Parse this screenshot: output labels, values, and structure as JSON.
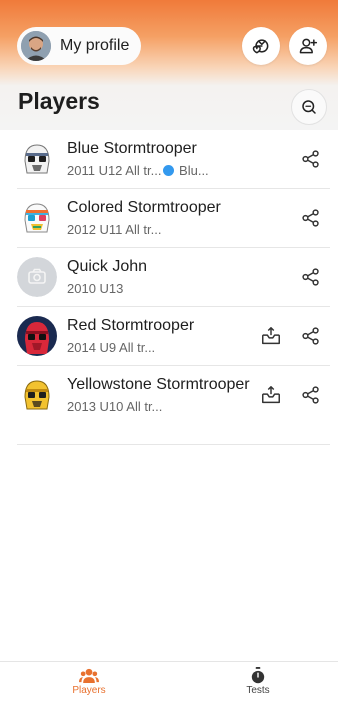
{
  "header": {
    "profile_label": "My profile"
  },
  "page": {
    "title": "Players"
  },
  "players": [
    {
      "name": "Blue Stormtrooper",
      "sub_before_dot": "2011 U12 All tr...",
      "sub_after_dot": " Blu...",
      "has_dot": true,
      "has_inbox": false
    },
    {
      "name": "Colored Stormtrooper",
      "sub_before_dot": "2012 U11 All tr...",
      "sub_after_dot": "",
      "has_dot": false,
      "has_inbox": false
    },
    {
      "name": "Quick John",
      "sub_before_dot": "2010 U13",
      "sub_after_dot": "",
      "has_dot": false,
      "has_inbox": false
    },
    {
      "name": "Red Stormtrooper",
      "sub_before_dot": "2014 U9 All tr...",
      "sub_after_dot": "",
      "has_dot": false,
      "has_inbox": true
    },
    {
      "name": "Yellowstone Stormtrooper",
      "sub_before_dot": "2013 U10 All tr...",
      "sub_after_dot": "",
      "has_dot": false,
      "has_inbox": true
    }
  ],
  "bottom_nav": {
    "players_label": "Players",
    "tests_label": "Tests"
  },
  "colors": {
    "accent": "#e8712f",
    "dot": "#3399ee",
    "icons": [
      "ball-heart-icon",
      "add-user-icon",
      "search-icon",
      "share-icon",
      "inbox-upload-icon",
      "camera-icon",
      "players-icon",
      "stopwatch-icon"
    ]
  }
}
